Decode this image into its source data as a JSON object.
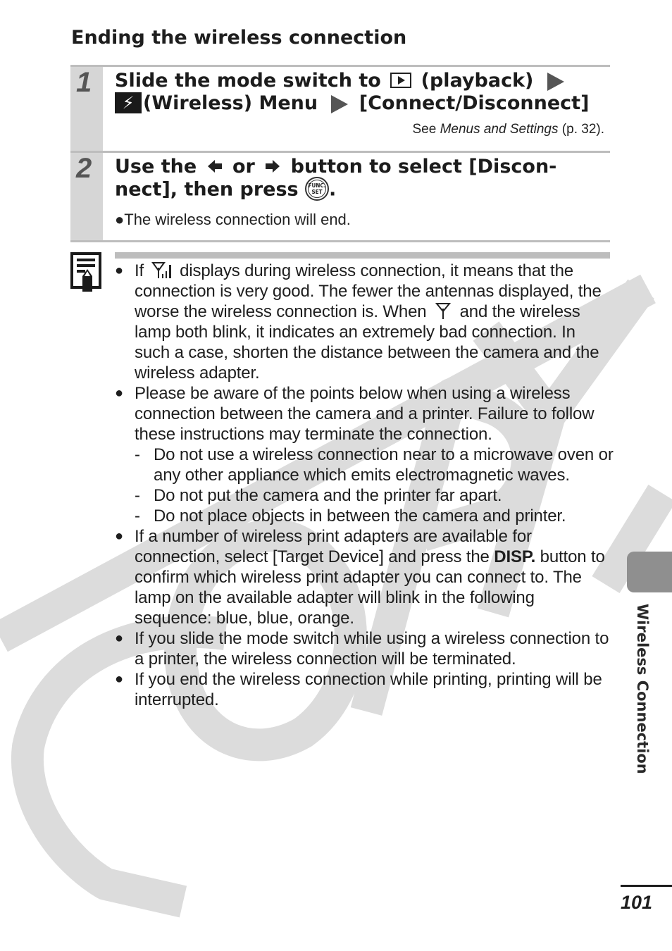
{
  "heading": "Ending the wireless connection",
  "steps": [
    {
      "number": "1",
      "title_part1": "Slide the mode switch to",
      "title_part2": "(playback)",
      "title_part3": "(Wireless) Menu",
      "title_part4": "[Connect/Disconnect]",
      "icons": [
        "playback-icon",
        "arrow-right-icon",
        "wireless-menu-icon",
        "arrow-right-icon"
      ],
      "ref_prefix": "See ",
      "ref_title": "Menus and Settings",
      "ref_suffix": " (p. 32)."
    },
    {
      "number": "2",
      "title_part1": "Use the",
      "title_part2": "or",
      "title_part3": "button to select [Discon-",
      "title_part4": "nect], then press",
      "title_part5": ".",
      "icons": [
        "left-button-icon",
        "right-button-icon",
        "func-set-icon"
      ],
      "func_set_label_top": "FUNC.",
      "func_set_label_bottom": "SET",
      "bullet_text": "The wireless connection will end."
    }
  ],
  "notes": {
    "icon": "note-icon",
    "items": [
      {
        "parts": [
          "If",
          "displays during wireless connection, it means that the connection is very good. The fewer the antennas displayed, the worse the wireless connection is. When",
          "and the wireless lamp both blink, it indicates an extremely bad connection. In such a case, shorten the distance between the camera and the wireless adapter."
        ],
        "icons": [
          "antenna-full-signal-icon",
          "antenna-no-signal-icon"
        ]
      },
      {
        "text": "Please be aware of the points below when using a wireless connection between the camera and a printer. Failure to follow these instructions may terminate the connection.",
        "sub_items": [
          "Do not use a wireless connection near to a microwave oven or any other appliance which emits electromagnetic waves.",
          "Do not put the camera and the printer far apart.",
          "Do not place objects in between the camera and printer."
        ]
      },
      {
        "text_before": "If a number of wireless print adapters are available for connection, select [Target Device] and press the ",
        "bold": "DISP.",
        "text_after": " button to confirm which wireless print adapter you can connect to. The lamp on the available adapter will blink in the following sequence: blue, blue, orange."
      },
      {
        "text": "If you slide the mode switch while using a wireless connection to a printer, the wireless connection will be terminated."
      },
      {
        "text": "If you end the wireless connection while printing, printing will be interrupted."
      }
    ]
  },
  "side_tab": {
    "label": "Wireless Connection",
    "color": "#8f8f8f"
  },
  "page_number": "101",
  "watermark": {
    "text": "COPY",
    "color": "#dcdcdc"
  },
  "colors": {
    "step_bar": "#d6d6d6",
    "rule": "#bdbdbd",
    "text": "#1e1e1e"
  }
}
